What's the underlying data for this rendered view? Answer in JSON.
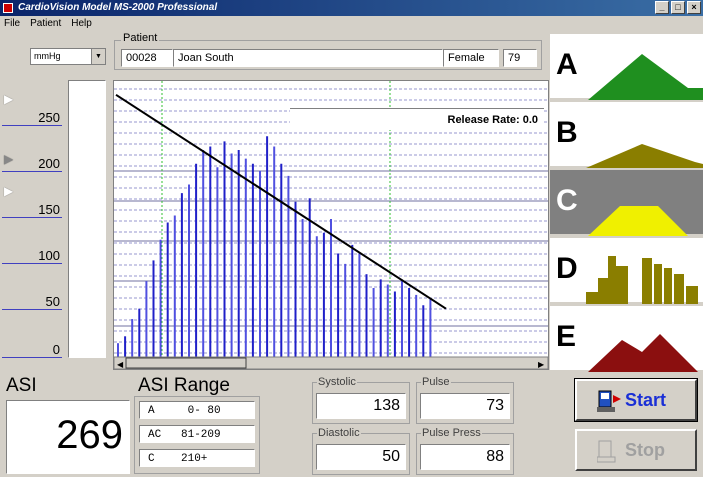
{
  "window": {
    "title": "CardioVision Model MS-2000 Professional",
    "buttons": [
      "_",
      "□",
      "×"
    ]
  },
  "menu": [
    "File",
    "Patient",
    "Help"
  ],
  "units": {
    "selected": "mmHg"
  },
  "patient": {
    "legend": "Patient",
    "id": "00028",
    "name": "Joan South",
    "sex": "Female",
    "age": "79"
  },
  "scale": {
    "labels": [
      "250",
      "200",
      "150",
      "100",
      "50",
      "0"
    ]
  },
  "chart": {
    "release_rate_label": "Release Rate: 0.0"
  },
  "chart_data": {
    "type": "bar",
    "series": [
      {
        "values": [
          8,
          12,
          22,
          28,
          44,
          56,
          68,
          78,
          82,
          95,
          100,
          112,
          120,
          122,
          110,
          125,
          118,
          120,
          115,
          112,
          108,
          128,
          122,
          112,
          105,
          90,
          80,
          92,
          70,
          72,
          80,
          60,
          54,
          65,
          60,
          48,
          40,
          45,
          42,
          38,
          45,
          40,
          36,
          30,
          34
        ]
      }
    ],
    "trend_line": {
      "start": 152,
      "end": 28
    }
  },
  "panels": [
    {
      "letter": "A",
      "color": "#1f8f1f"
    },
    {
      "letter": "B",
      "color": "#8a7e00"
    },
    {
      "letter": "C",
      "color": "#f0f000"
    },
    {
      "letter": "D",
      "color": "#8a7e00"
    },
    {
      "letter": "E",
      "color": "#8b0f0f"
    }
  ],
  "asi": {
    "label": "ASI",
    "value": "269"
  },
  "asi_range": {
    "label": "ASI Range",
    "rows": [
      "A     0- 80",
      "AC   81-209",
      "C    210+"
    ]
  },
  "vitals": {
    "systolic": {
      "label": "Systolic",
      "value": "138"
    },
    "pulse": {
      "label": "Pulse",
      "value": "73"
    },
    "diastolic": {
      "label": "Diastolic",
      "value": "50"
    },
    "pulse_press": {
      "label": "Pulse Press",
      "value": "88"
    }
  },
  "buttons": {
    "start": "Start",
    "stop": "Stop"
  }
}
